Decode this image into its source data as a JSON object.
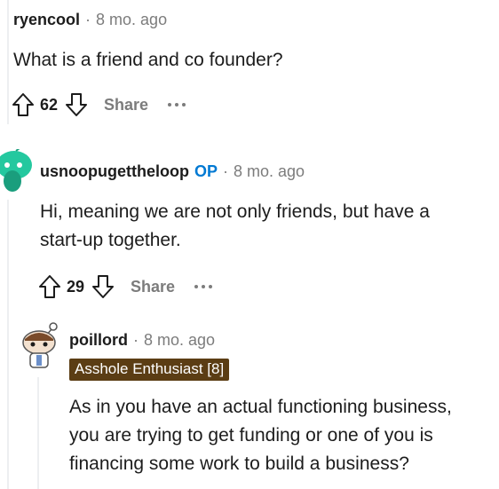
{
  "comments": [
    {
      "username": "ryencool",
      "separator": "·",
      "time": "8 mo. ago",
      "body": "What is a friend and co founder?",
      "score": "62",
      "share_label": "Share"
    },
    {
      "username": "usnoopugettheloop",
      "op_badge": "OP",
      "separator": "·",
      "time": "8 mo. ago",
      "body_lines": [
        "Hi, meaning we are not only friends, but have a",
        "start-up together."
      ],
      "score": "29",
      "share_label": "Share"
    },
    {
      "username": "poillord",
      "separator": "·",
      "time": "8 mo. ago",
      "flair": "Asshole Enthusiast [8]",
      "body_lines": [
        "As in you have an actual functioning business,",
        "you are trying to get funding or one of you is",
        "financing some work to build a business?"
      ]
    }
  ],
  "colors": {
    "op_blue": "#0079d3",
    "flair_bg": "#5b3d14",
    "avatar_teal": "#24c89f",
    "meta_gray": "#7c7c7c"
  },
  "icons": [
    "upvote-icon",
    "downvote-icon",
    "more-options-icon",
    "snoo-avatar-icon"
  ]
}
